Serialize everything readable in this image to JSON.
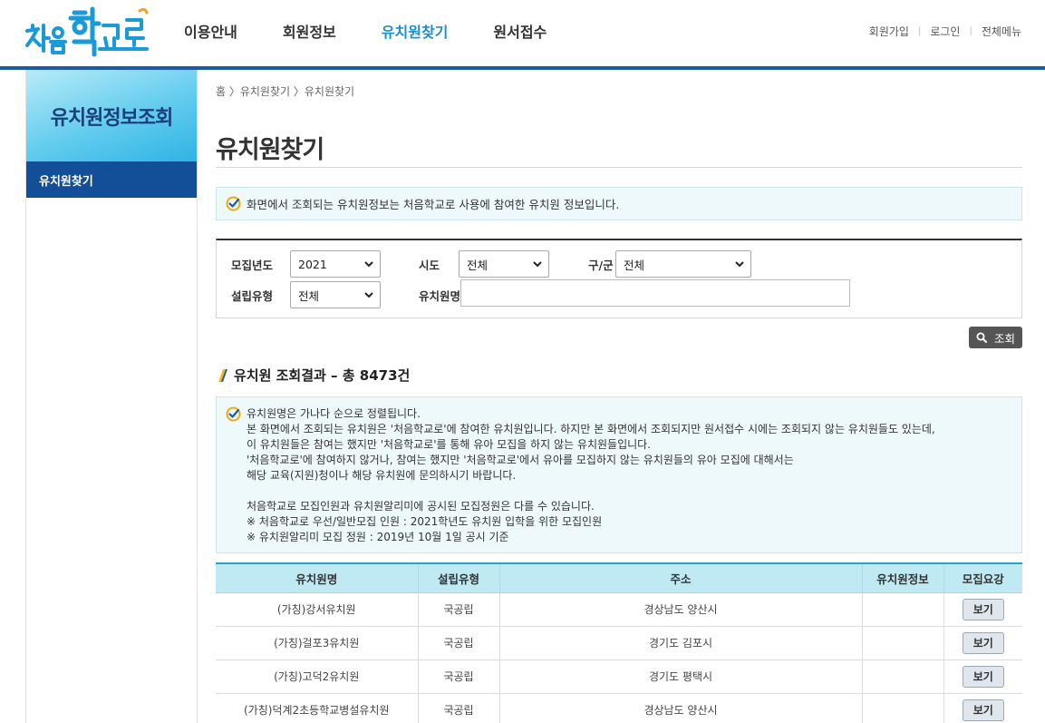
{
  "header": {
    "logo_text": "처음학교로",
    "nav": [
      "이용안내",
      "회원정보",
      "유치원찾기",
      "원서접수"
    ],
    "active_nav": "유치원찾기",
    "util": {
      "join": "회원가입",
      "login": "로그인",
      "all_menu": "전체메뉴"
    }
  },
  "sidebar": {
    "title": "유치원정보조회",
    "items": [
      {
        "label": "유치원찾기",
        "active": true
      }
    ]
  },
  "breadcrumb": "홈 〉유치원찾기 〉유치원찾기",
  "page_title": "유치원찾기",
  "notice": "화면에서 조회되는 유치원정보는 처음학교로 사용에 참여한 유치원 정보입니다.",
  "search": {
    "year_label": "모집년도",
    "year_value": "2021",
    "sido_label": "시도",
    "sido_value": "전체",
    "gugun_label": "구/군",
    "gugun_value": "전체",
    "type_label": "설립유형",
    "type_value": "전체",
    "name_label": "유치원명",
    "name_value": "",
    "button_label": "조회"
  },
  "result": {
    "title": "유치원 조회결과 – 총 8473건",
    "info_lines": [
      "유치원명은 가나다 순으로 정렬됩니다.",
      "본 화면에서 조회되는 유치원은 '처음학교로'에 참여한 유치원입니다. 하지만 본 화면에서 조회되지만 원서접수 시에는 조회되지 않는 유치원들도 있는데,",
      "이 유치원들은 참여는 했지만 '처음학교로'를 통해 유아 모집을 하지 않는 유치원들입니다.",
      "'처음학교로'에 참여하지 않거나, 참여는 했지만 '처음학교로'에서 유아를 모집하지 않는 유치원들의 유아 모집에 대해서는",
      "해당 교육(지원)청이나 해당 유치원에 문의하시기 바랍니다.",
      "",
      "처음학교로 모집인원과 유치원알리미에 공시된 모집정원은 다를 수 있습니다.",
      " ※ 처음학교로 우선/일반모집 인원 : 2021학년도 유치원 입학을 위한 모집인원",
      " ※ 유치원알리미 모집 정원 : 2019년 10월 1일 공시 기준"
    ],
    "columns": [
      "유치원명",
      "설립유형",
      "주소",
      "유치원정보",
      "모집요강"
    ],
    "view_label": "보기",
    "rows": [
      {
        "name": "(가칭)강서유치원",
        "type": "국공립",
        "address": "경상남도 양산시",
        "info": ""
      },
      {
        "name": "(가칭)걸포3유치원",
        "type": "국공립",
        "address": "경기도 김포시",
        "info": ""
      },
      {
        "name": "(가칭)고덕2유치원",
        "type": "국공립",
        "address": "경기도 평택시",
        "info": ""
      },
      {
        "name": "(가칭)덕계2초등학교병설유치원",
        "type": "국공립",
        "address": "경상남도 양산시",
        "info": ""
      }
    ]
  }
}
